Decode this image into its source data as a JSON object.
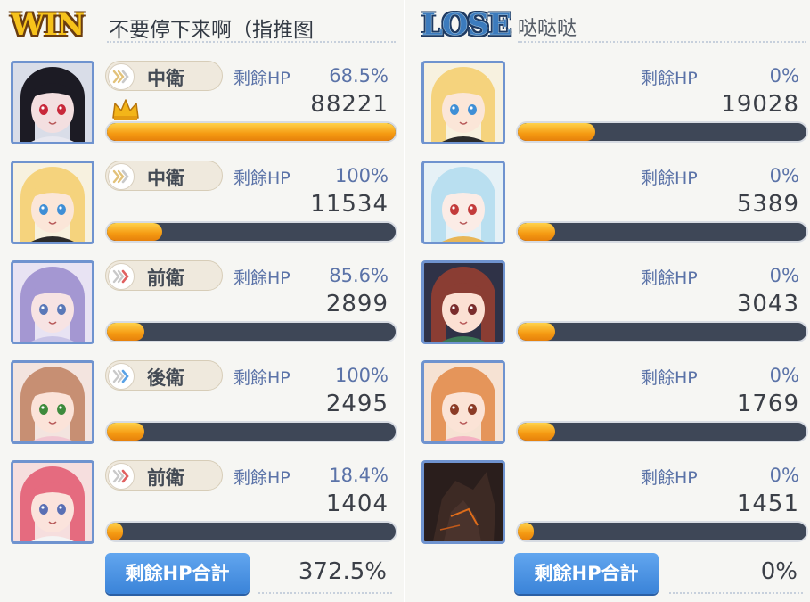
{
  "colors": {
    "bar_fill": "#f59a12",
    "bar_track": "#3e4757",
    "avatar_border": "#6f93cf",
    "total_button": "#4a94e6",
    "win_logo": "#f6c21b",
    "lose_logo": "#3c7bbd"
  },
  "win": {
    "logo": "WIN",
    "team_name": "不要停下来啊（指推图",
    "hp_label": "剩餘HP",
    "total_label": "剩餘HP合計",
    "total_value": "372.5%",
    "members": [
      {
        "role": "中衛",
        "role_icon": "chevron-grey-icon",
        "hp_pct": "68.5%",
        "damage": "88221",
        "bar_fraction": 1.0,
        "mvp": true,
        "avatar": "dark-hair-red-eyes-avatar"
      },
      {
        "role": "中衛",
        "role_icon": "chevron-grey-icon",
        "hp_pct": "100%",
        "damage": "11534",
        "bar_fraction": 0.19,
        "mvp": false,
        "avatar": "blonde-blue-eyes-avatar"
      },
      {
        "role": "前衛",
        "role_icon": "chevron-red-icon",
        "hp_pct": "85.6%",
        "damage": "2899",
        "bar_fraction": 0.13,
        "mvp": false,
        "avatar": "purple-hair-avatar"
      },
      {
        "role": "後衛",
        "role_icon": "chevron-blue-icon",
        "hp_pct": "100%",
        "damage": "2495",
        "bar_fraction": 0.13,
        "mvp": false,
        "avatar": "brown-hair-wink-avatar"
      },
      {
        "role": "前衛",
        "role_icon": "chevron-red-icon",
        "hp_pct": "18.4%",
        "damage": "1404",
        "bar_fraction": 0.05,
        "mvp": false,
        "avatar": "pink-hair-avatar"
      }
    ]
  },
  "lose": {
    "logo": "LOSE",
    "team_name": "哒哒哒",
    "hp_label": "剩餘HP",
    "total_label": "剩餘HP合計",
    "total_value": "0%",
    "members": [
      {
        "hp_pct": "0%",
        "damage": "19028",
        "bar_fraction": 0.27,
        "avatar": "blonde-blue-eyes-avatar"
      },
      {
        "hp_pct": "0%",
        "damage": "5389",
        "bar_fraction": 0.13,
        "avatar": "light-blue-hair-avatar"
      },
      {
        "hp_pct": "0%",
        "damage": "3043",
        "bar_fraction": 0.13,
        "avatar": "brown-hair-cheer-avatar"
      },
      {
        "hp_pct": "0%",
        "damage": "1769",
        "bar_fraction": 0.13,
        "avatar": "orange-hair-avatar"
      },
      {
        "hp_pct": "0%",
        "damage": "1451",
        "bar_fraction": 0.05,
        "avatar": "dark-creature-avatar"
      }
    ]
  }
}
